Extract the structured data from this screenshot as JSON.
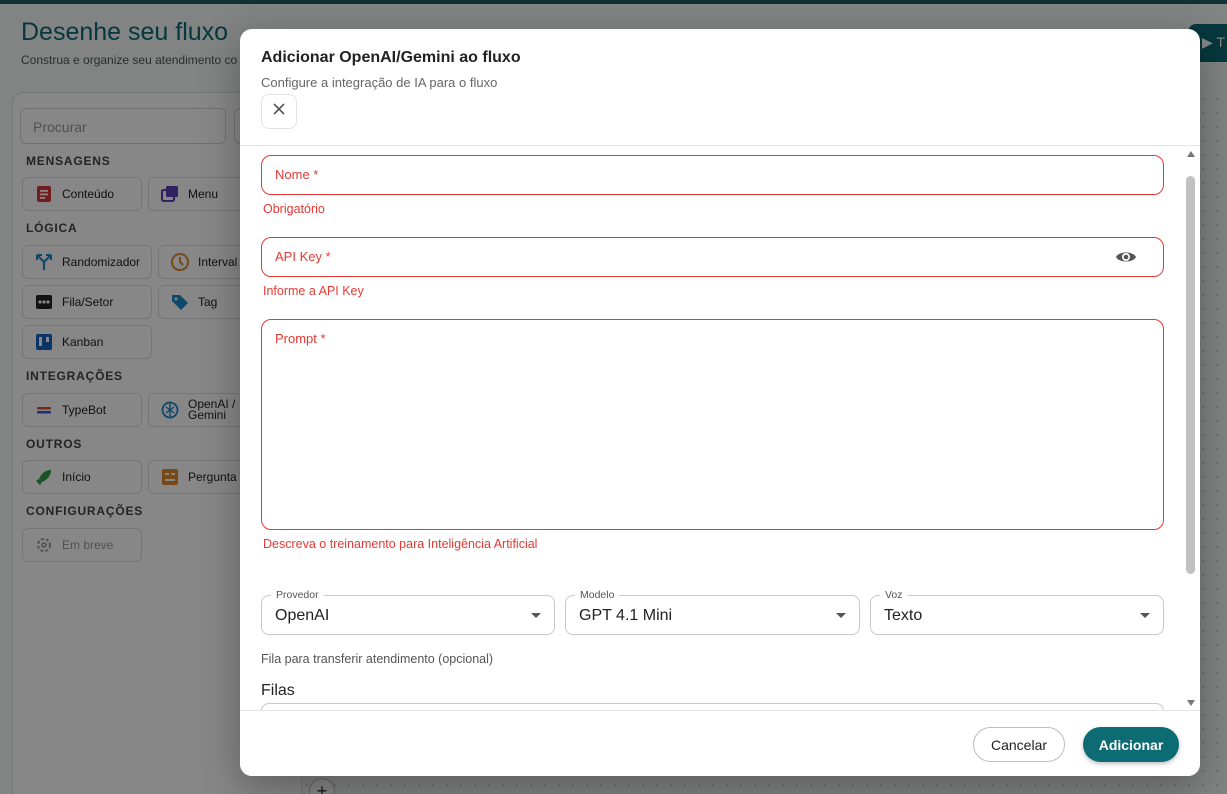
{
  "background": {
    "title": "Desenhe seu fluxo",
    "subtitle": "Construa e organize seu atendimento co",
    "run_label": "▶ T",
    "search_placeholder": "Procurar",
    "sections": {
      "mensagens": "MENSAGENS",
      "logica": "LÓGICA",
      "integracoes": "INTEGRAÇÕES",
      "outros": "OUTROS",
      "configuracoes": "CONFIGURAÇÕES"
    },
    "items": {
      "conteudo": "Conteúdo",
      "menu": "Menu",
      "randomizador": "Randomizador",
      "intervalo": "Interval",
      "fila_setor": "Fila/Setor",
      "tag": "Tag",
      "kanban": "Kanban",
      "typebot": "TypeBot",
      "openai_line1": "OpenAI /",
      "openai_line2": "Gemini",
      "inicio": "Início",
      "pergunta": "Pergunta",
      "em_breve": "Em breve"
    },
    "plus": "+"
  },
  "dialog": {
    "title": "Adicionar OpenAI/Gemini ao fluxo",
    "subtitle": "Configure a integração de IA para o fluxo",
    "fields": {
      "nome": {
        "label": "Nome *",
        "value": "",
        "helper": "Obrigatório"
      },
      "api_key": {
        "label": "API Key *",
        "value": "",
        "helper": "Informe a API Key"
      },
      "prompt": {
        "label": "Prompt *",
        "value": "",
        "helper": "Descreva o treinamento para Inteligência Artificial"
      }
    },
    "selects": {
      "provedor": {
        "label": "Provedor",
        "value": "OpenAI"
      },
      "modelo": {
        "label": "Modelo",
        "value": "GPT 4.1 Mini"
      },
      "voz": {
        "label": "Voz",
        "value": "Texto"
      }
    },
    "queue_label": "Fila para transferir atendimento (opcional)",
    "filas": {
      "title": "Filas",
      "value": "-"
    },
    "buttons": {
      "cancel": "Cancelar",
      "add": "Adicionar"
    }
  },
  "colors": {
    "primary": "#0d6b74",
    "error": "#e53935"
  }
}
